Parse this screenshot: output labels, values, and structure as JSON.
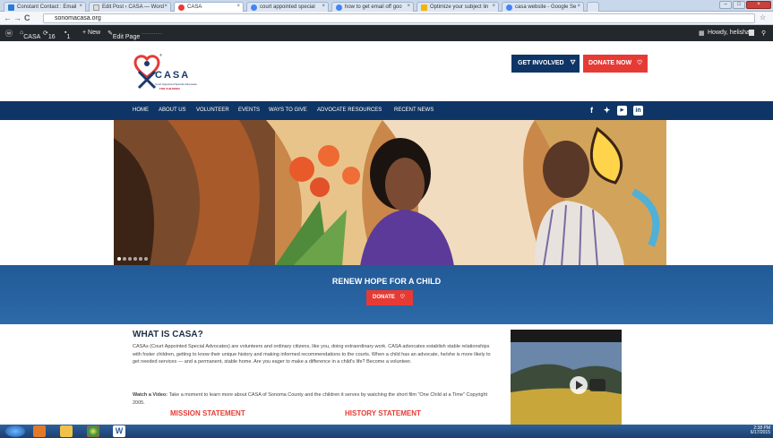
{
  "browser": {
    "tabs": [
      {
        "title": "Constant Contact : Email",
        "color": "#2b7bd6"
      },
      {
        "title": "Edit Post ‹ CASA — Word",
        "color": "#777777"
      },
      {
        "title": "CASA",
        "color": "#e63b35"
      },
      {
        "title": "court appointed special",
        "color": "#4285f4"
      },
      {
        "title": "how to get email off goo",
        "color": "#4285f4"
      },
      {
        "title": "Optimize your subject lin",
        "color": "#f4b400"
      },
      {
        "title": "casa website - Google Se",
        "color": "#4285f4"
      }
    ],
    "url": "sonomacasa.org"
  },
  "wp_admin": {
    "site": "CASA",
    "updates": "16",
    "comments": "1",
    "new_label": "+ New",
    "edit_label": "Edit Page",
    "howdy": "Howdy, helisha"
  },
  "site": {
    "logo_word": "CASA",
    "logo_sub": "Court Appointed Special Advocates",
    "logo_sub2": "FOR CHILDREN",
    "get_involved": "GET INVOLVED",
    "donate_now": "DONATE NOW",
    "nav": [
      "HOME",
      "ABOUT US",
      "VOLUNTEER",
      "EVENTS",
      "WAYS TO GIVE",
      "ADVOCATE RESOURCES",
      "RECENT NEWS"
    ],
    "social": [
      "f",
      "t",
      "You Tube",
      "in"
    ],
    "banner_title": "RENEW HOPE FOR A CHILD",
    "banner_donate": "DONATE",
    "what_title": "WHAT IS CASA?",
    "what_text": "CASAs (Court Appointed Special Advocates) are volunteers and ordinary citizens, like you, doing extraordinary work. CASA advocates establish stable relationships with foster children, getting to know their unique history and making informed recommendations to the courts. When a child has an advocate, he/she is more likely to get needed services — and a permanent, stable home. Are you eager to make a difference in a child's life? Become a volunteer.",
    "watch_label": "Watch a Video:",
    "watch_text": "Take a moment to learn more about CASA of Sonoma County and the children it serves by watching the short film \"One Child at a Time\" Copyright 2005.",
    "mission": "MISSION STATEMENT",
    "history": "HISTORY STATEMENT"
  },
  "taskbar": {
    "time": "2:38 PM",
    "date": "6/17/2015"
  },
  "colors": {
    "navy": "#0f3566",
    "red": "#e63b35",
    "banner": "#2d6aa8"
  }
}
